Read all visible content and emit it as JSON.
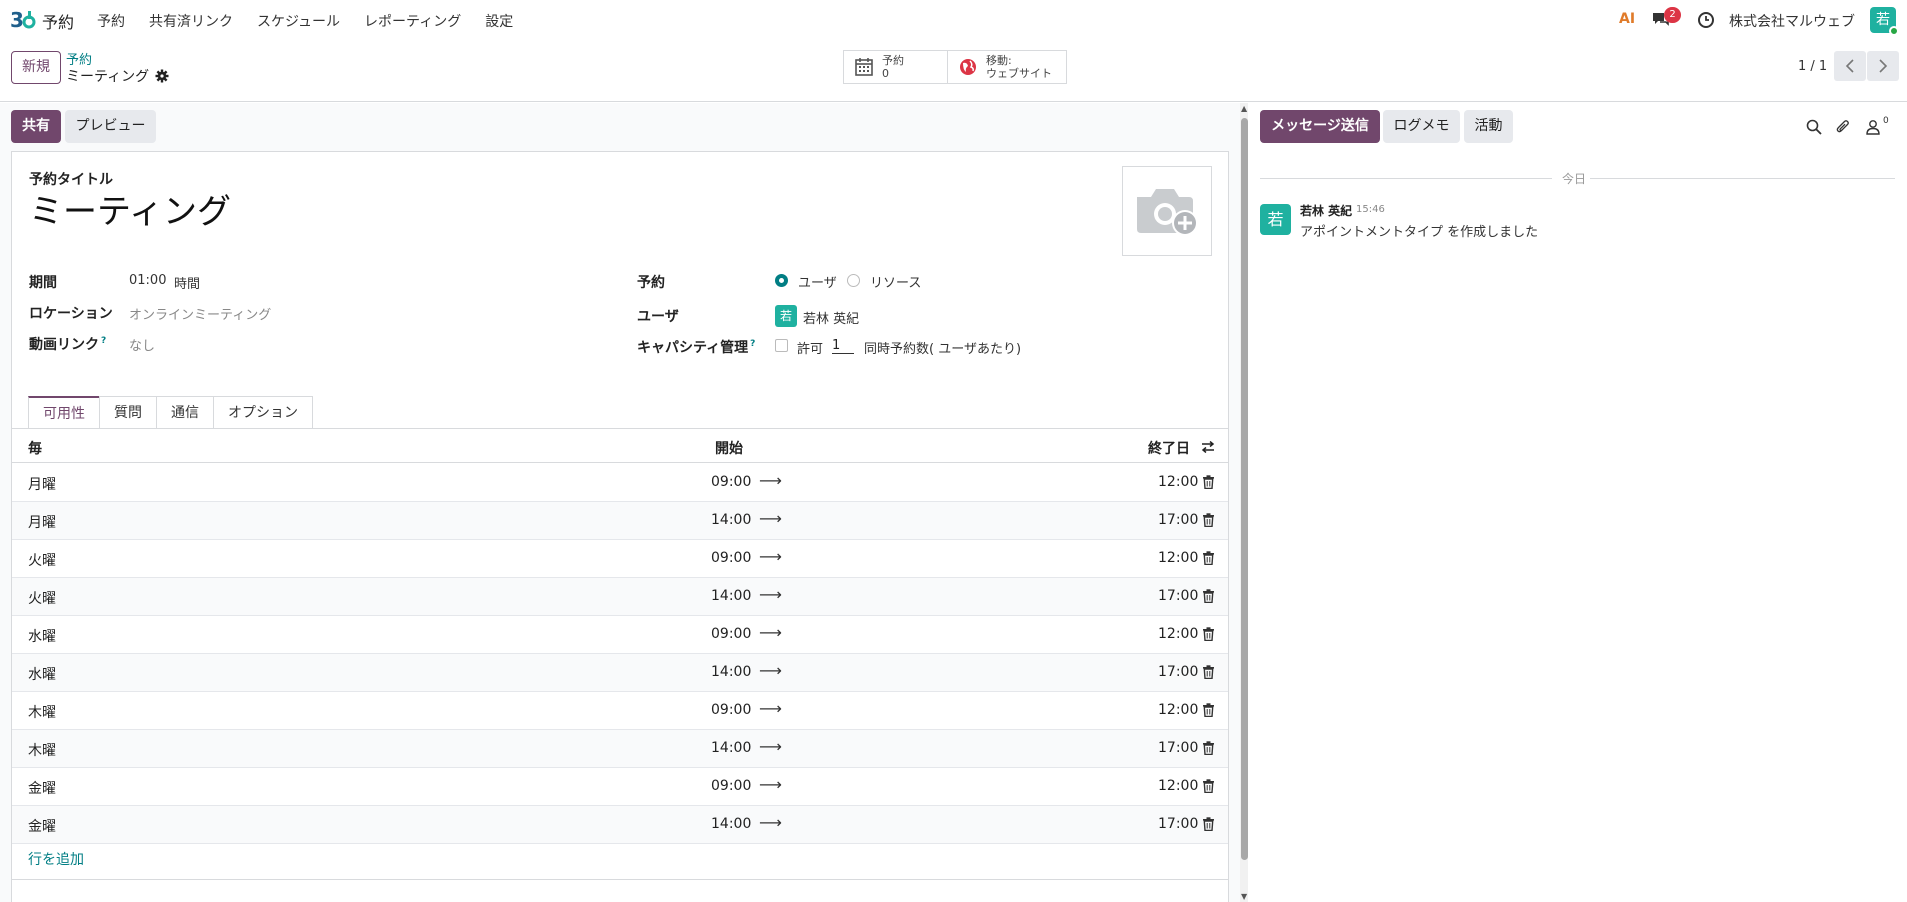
{
  "navbar": {
    "app_name": "予約",
    "menu": [
      "予約",
      "共有済リンク",
      "スケジュール",
      "レポーティング",
      "設定"
    ],
    "ai_label": "AI",
    "chat_badge": "2",
    "company": "株式会社マルウェブ",
    "avatar": "若"
  },
  "control": {
    "new_label": "新規",
    "breadcrumb_parent": "予約",
    "breadcrumb_current": "ミーティング",
    "stat_appointments_label": "予約",
    "stat_appointments_value": "0",
    "stat_website_label": "移動:",
    "stat_website_value": "ウェブサイト",
    "pager": "1 / 1"
  },
  "actions": {
    "share": "共有",
    "preview": "プレビュー"
  },
  "form": {
    "title_label": "予約タイトル",
    "title_value": "ミーティング",
    "duration_label": "期間",
    "duration_value": "01:00",
    "duration_unit": "時間",
    "location_label": "ロケーション",
    "location_value": "オンラインミーティング",
    "video_label": "動画リンク",
    "video_value": "なし",
    "help_mark": "?",
    "schedule_label": "予約",
    "schedule_opt_user": "ユーザ",
    "schedule_opt_resource": "リソース",
    "users_label": "ユーザ",
    "user_avatar": "若",
    "user_name": "若林 英紀",
    "capacity_label": "キャパシティ管理",
    "capacity_allow": "許可",
    "capacity_value": "1",
    "capacity_text": "同時予約数( ユーザあたり)"
  },
  "tabs": [
    "可用性",
    "質問",
    "通信",
    "オプション"
  ],
  "table": {
    "headers": {
      "every": "毎",
      "start": "開始",
      "end": "終了日"
    },
    "rows": [
      {
        "day": "月曜",
        "start": "09:00",
        "end": "12:00"
      },
      {
        "day": "月曜",
        "start": "14:00",
        "end": "17:00"
      },
      {
        "day": "火曜",
        "start": "09:00",
        "end": "12:00"
      },
      {
        "day": "火曜",
        "start": "14:00",
        "end": "17:00"
      },
      {
        "day": "水曜",
        "start": "09:00",
        "end": "12:00"
      },
      {
        "day": "水曜",
        "start": "14:00",
        "end": "17:00"
      },
      {
        "day": "木曜",
        "start": "09:00",
        "end": "12:00"
      },
      {
        "day": "木曜",
        "start": "14:00",
        "end": "17:00"
      },
      {
        "day": "金曜",
        "start": "09:00",
        "end": "12:00"
      },
      {
        "day": "金曜",
        "start": "14:00",
        "end": "17:00"
      }
    ],
    "add_line": "行を追加"
  },
  "chatter": {
    "send_message": "メッセージ送信",
    "log_note": "ログメモ",
    "activity": "活動",
    "followers_count": "0",
    "today": "今日",
    "message": {
      "avatar": "若",
      "author": "若林 英紀",
      "time": "15:46",
      "body": "アポイントメントタイプ を作成しました"
    }
  },
  "colors": {
    "brand": "#71476c",
    "accent": "#017e84",
    "avatar": "#1fb1a0",
    "badge": "#dc3545"
  }
}
